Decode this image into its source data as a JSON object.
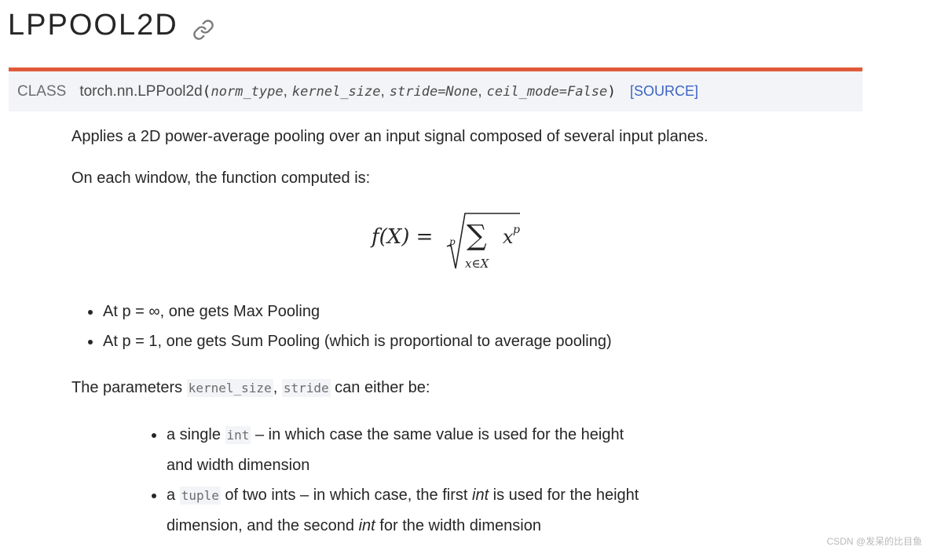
{
  "header": {
    "title": "LPPOOL2D",
    "permalink_icon": "link-icon"
  },
  "signature": {
    "kind": "CLASS",
    "name": "torch.nn.LPPool2d",
    "open_paren": "(",
    "close_paren": ")",
    "params": [
      "norm_type",
      "kernel_size",
      "stride=None",
      "ceil_mode=False"
    ],
    "separator": ",",
    "source_link": "[SOURCE]",
    "accent_color": "#e05a3a",
    "link_color": "#3b64c4"
  },
  "description": {
    "summary": "Applies a 2D power-average pooling over an input signal composed of several input planes.",
    "function_intro": "On each window, the function computed is:",
    "formula": {
      "lhs": "f(X) =",
      "root_index": "p",
      "sum_symbol": "∑",
      "sum_subscript": "x∈X",
      "term": "x",
      "exponent": "p"
    },
    "cases": [
      {
        "prefix": "At p = ",
        "symbol": "∞",
        "suffix": ", one gets Max Pooling"
      },
      {
        "prefix": "At p = 1, one gets Sum Pooling (which is proportional to average pooling)",
        "symbol": "",
        "suffix": ""
      }
    ],
    "params_intro": {
      "prefix": "The parameters ",
      "code1": "kernel_size",
      "sep": ", ",
      "code2": "stride",
      "suffix": " can either be:"
    },
    "param_options": [
      {
        "prefix": "a single ",
        "code": "int",
        "text": " – in which case the same value is used for the height and width dimension"
      },
      {
        "prefix": "a ",
        "code": "tuple",
        "text1": " of two ints – in which case, the first ",
        "em1": "int",
        "text2": " is used for the height dimension, and the second ",
        "em2": "int",
        "text3": " for the width dimension"
      }
    ]
  },
  "watermark": "CSDN @发呆的比目鱼"
}
